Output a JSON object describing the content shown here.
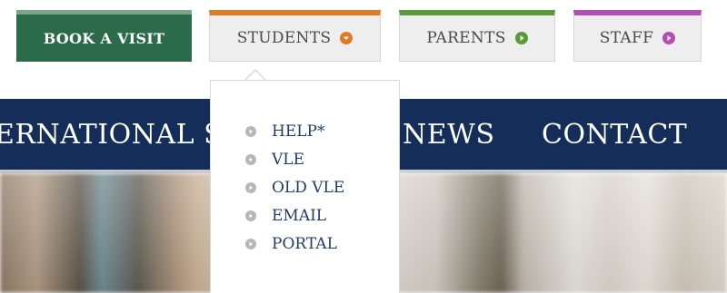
{
  "header": {
    "book_visit_label": "BOOK A VISIT",
    "students_label": "STUDENTS",
    "parents_label": "PARENTS",
    "staff_label": "STAFF"
  },
  "colors": {
    "book_visit_bg": "#2b6b4a",
    "students_accent": "#e07a24",
    "parents_accent": "#5a9a3a",
    "staff_accent": "#b24fb4",
    "navbar_bg": "#142d59",
    "dropdown_text": "#1f3d6e"
  },
  "icons": {
    "students": "chevron-down-circle-icon",
    "parents": "play-circle-icon",
    "staff": "play-circle-icon",
    "dropdown_bullet": "play-circle-icon"
  },
  "nav": {
    "items": [
      {
        "label": "ERNATIONAL S"
      },
      {
        "label": "NEWS"
      },
      {
        "label": "CONTACT"
      }
    ]
  },
  "dropdown": {
    "items": [
      {
        "label": "HELP*"
      },
      {
        "label": "VLE"
      },
      {
        "label": "OLD VLE"
      },
      {
        "label": "EMAIL"
      },
      {
        "label": "PORTAL"
      }
    ]
  }
}
